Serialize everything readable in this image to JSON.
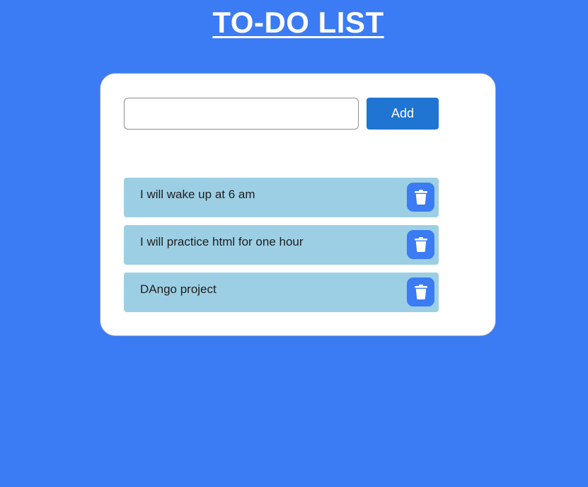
{
  "header": {
    "title": "TO-DO LIST"
  },
  "form": {
    "input_value": "",
    "input_placeholder": "",
    "add_label": "Add"
  },
  "tasks": [
    {
      "text": "I will wake up at 6 am",
      "delete_icon": "trash-icon"
    },
    {
      "text": "I will practice html for one hour",
      "delete_icon": "trash-icon"
    },
    {
      "text": "DAngo project",
      "delete_icon": "trash-icon"
    }
  ],
  "colors": {
    "background": "#3b7bf4",
    "card": "#ffffff",
    "add_button": "#1f75d1",
    "task_item": "#9dcfe4",
    "delete_button": "#3b7bf4"
  }
}
